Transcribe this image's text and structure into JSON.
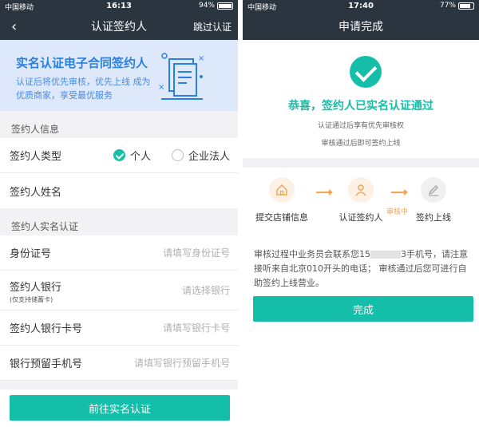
{
  "left": {
    "status": {
      "carrier": "中国移动",
      "time": "16:13",
      "battery": "94%"
    },
    "nav": {
      "back": "‹",
      "title": "认证签约人",
      "skip": "跳过认证"
    },
    "banner": {
      "title": "实名认证电子合同签约人",
      "subtitle": "认证后将优先审核，优先上线 成为优质商家，享受最优服务"
    },
    "section1": "签约人信息",
    "signer_type": {
      "label": "签约人类型",
      "opt_personal": "个人",
      "opt_company": "企业法人"
    },
    "signer_name": {
      "label": "签约人姓名"
    },
    "section2": "签约人实名认证",
    "id_row": {
      "label": "身份证号",
      "placeholder": "请填写身份证号"
    },
    "bank_row": {
      "label": "签约人银行",
      "sublabel": "(仅支持储蓄卡)",
      "placeholder": "请选择银行"
    },
    "card_row": {
      "label": "签约人银行卡号",
      "placeholder": "请填写银行卡号"
    },
    "phone_row": {
      "label": "银行预留手机号",
      "placeholder": "请填写银行预留手机号"
    },
    "submit": "前往实名认证"
  },
  "right": {
    "status": {
      "carrier": "中国移动",
      "time": "17:40",
      "battery": "77%"
    },
    "nav": {
      "title": "申请完成"
    },
    "congrats": "恭喜，签约人已实名认证通过",
    "note1": "认证通过后享有优先审核权",
    "note2": "审核通过后即可签约上线",
    "steps": [
      "提交店铺信息",
      "认证签约人",
      "签约上线"
    ],
    "tag": "审核中",
    "desc_a": "审核过程中业务员会联系您15",
    "desc_b": "3手机号，请注意接听来自北京010开头的电话； 审核通过后您可进行自助签约上线营业。",
    "done": "完成"
  },
  "colors": {
    "accent": "#15bea8",
    "header": "#2b3540",
    "banner": "#dde9fb",
    "orange": "#f5a44e"
  }
}
